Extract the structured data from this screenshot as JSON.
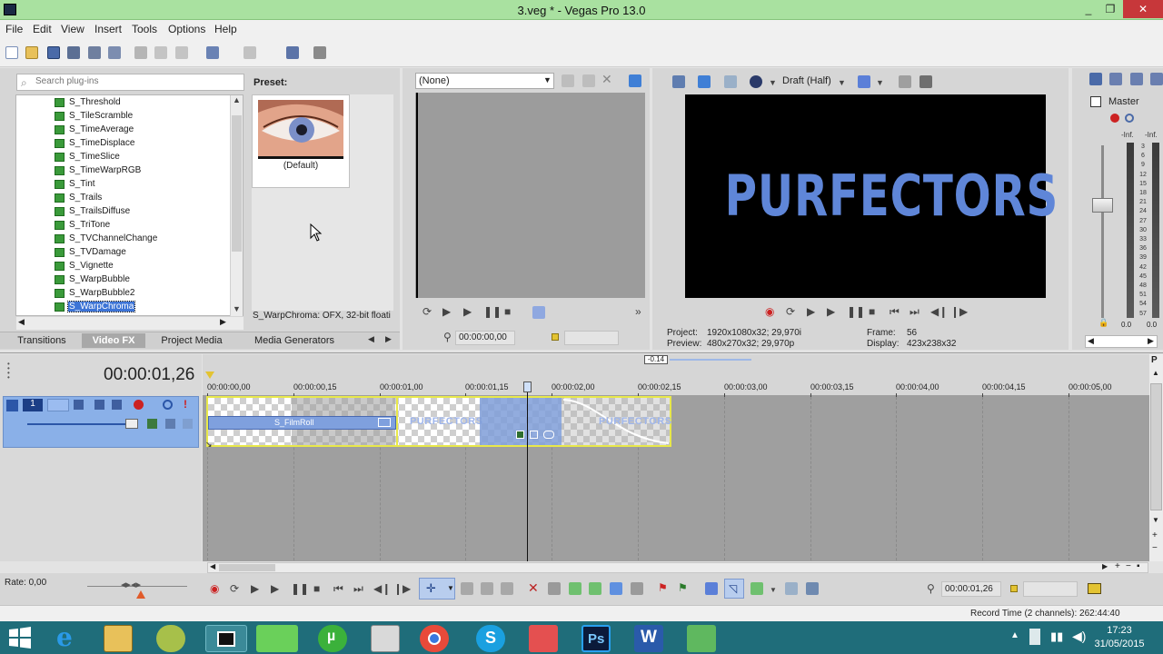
{
  "window": {
    "title": "3.veg * - Vegas Pro 13.0",
    "minimize": "_",
    "maximize": "❐",
    "close": "✕"
  },
  "menu": [
    "File",
    "Edit",
    "View",
    "Insert",
    "Tools",
    "Options",
    "Help"
  ],
  "plugin_search": {
    "placeholder": "Search plug-ins"
  },
  "plugins": [
    "S_Threshold",
    "S_TileScramble",
    "S_TimeAverage",
    "S_TimeDisplace",
    "S_TimeSlice",
    "S_TimeWarpRGB",
    "S_Tint",
    "S_Trails",
    "S_TrailsDiffuse",
    "S_TriTone",
    "S_TVChannelChange",
    "S_TVDamage",
    "S_Vignette",
    "S_WarpBubble",
    "S_WarpBubble2",
    "S_WarpChroma"
  ],
  "selected_plugin": "S_WarpChroma",
  "preset": {
    "label": "Preset:",
    "name": "(Default)",
    "description": "S_WarpChroma: OFX, 32-bit floati"
  },
  "dock_tabs": [
    "Transitions",
    "Video FX",
    "Project Media",
    "Media Generators"
  ],
  "active_tab": "Video FX",
  "trimmer": {
    "source": "(None)",
    "timecode": "00:00:00,00"
  },
  "preview": {
    "quality": "Draft (Half)",
    "overlay_text": "PURFECTORS",
    "project_label": "Project:",
    "project_value": "1920x1080x32; 29,970i",
    "preview_label": "Preview:",
    "preview_value": "480x270x32; 29,970p",
    "frame_label": "Frame:",
    "frame_value": "56",
    "display_label": "Display:",
    "display_value": "423x238x32"
  },
  "mixer": {
    "title": "Master",
    "inf_left": "-Inf.",
    "inf_right": "-Inf.",
    "scale": [
      "3",
      "6",
      "9",
      "12",
      "15",
      "18",
      "21",
      "24",
      "27",
      "30",
      "33",
      "36",
      "39",
      "42",
      "45",
      "48",
      "51",
      "54",
      "57"
    ],
    "bottom_left": "0.0",
    "bottom_right": "0.0"
  },
  "timeline": {
    "cursor_time": "00:00:01,26",
    "offset": "-0.14",
    "ruler": [
      "00:00:00,00",
      "00:00:00,15",
      "00:00:01,00",
      "00:00:01,15",
      "00:00:02,00",
      "00:00:02,15",
      "00:00:03,00",
      "00:00:03,15",
      "00:00:04,00",
      "00:00:04,15",
      "00:00:05,00"
    ],
    "fx_label": "S_FilmRoll",
    "clip_text_1": "PURFECTORS",
    "clip_text_2": "PURFECTORS"
  },
  "rate": "Rate: 0,00",
  "transport_time": "00:00:01,26",
  "record_time": "Record Time (2 channels): 262:44:40",
  "clock": {
    "time": "17:23",
    "date": "31/05/2015"
  },
  "taskbar_labels": {
    "photoshop": "Ps",
    "word": "W"
  },
  "colors": {
    "titlebar": "#a9e1a0",
    "accent_blue": "#5f86d8",
    "selection": "#3d74d6",
    "clip_border": "#e8e84a",
    "taskbar": "#1f6d7a"
  }
}
